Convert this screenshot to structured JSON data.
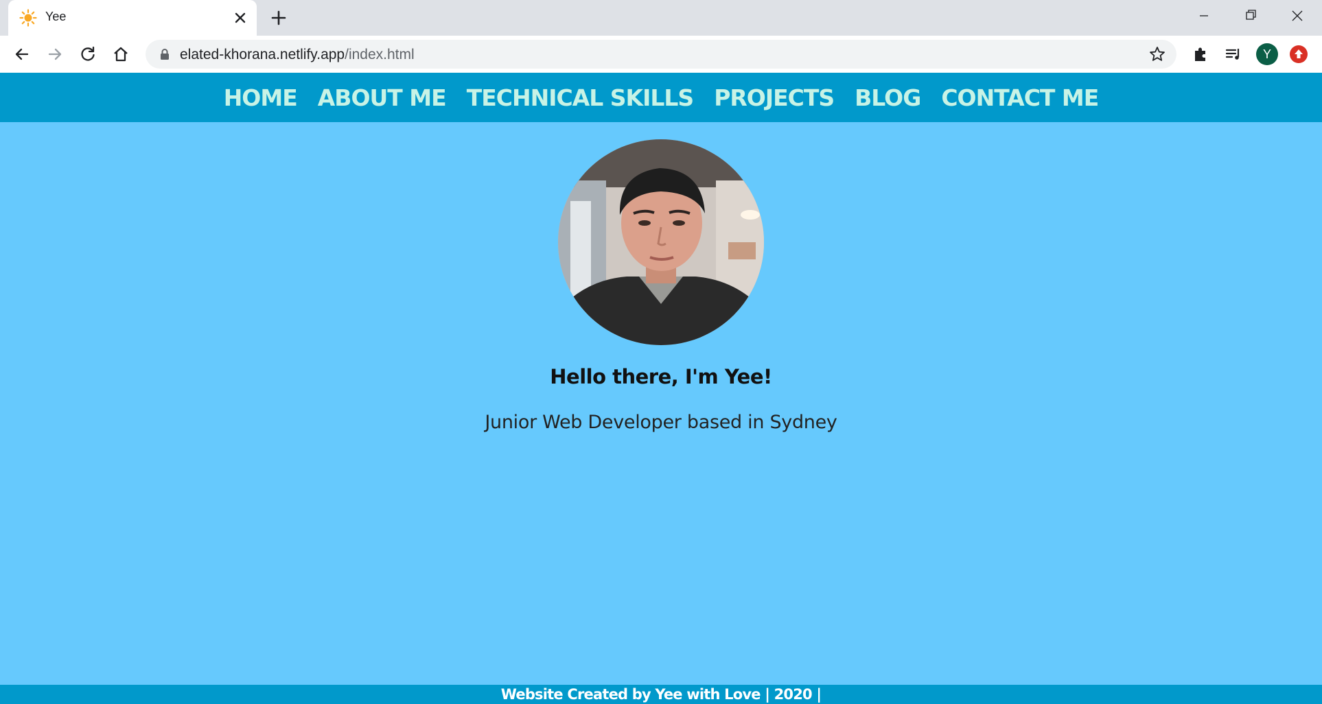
{
  "browser": {
    "tab": {
      "title": "Yee",
      "favicon": "sun-icon"
    },
    "url": {
      "host": "elated-khorana.netlify.app",
      "path": "/index.html"
    },
    "profile_initial": "Y"
  },
  "nav": {
    "items": [
      {
        "label": "HOME"
      },
      {
        "label": "ABOUT ME"
      },
      {
        "label": "TECHNICAL SKILLS"
      },
      {
        "label": "PROJECTS"
      },
      {
        "label": "BLOG"
      },
      {
        "label": "CONTACT ME"
      }
    ]
  },
  "hero": {
    "greeting": "Hello there, I'm Yee!",
    "tagline": "Junior Web Developer based in Sydney"
  },
  "footer": {
    "text": "Website Created by Yee with Love | 2020 |"
  },
  "colors": {
    "nav_bg": "#0199cb",
    "nav_text": "#c8f3e6",
    "page_bg": "#66c9fd",
    "footer_bg": "#0199cb"
  }
}
